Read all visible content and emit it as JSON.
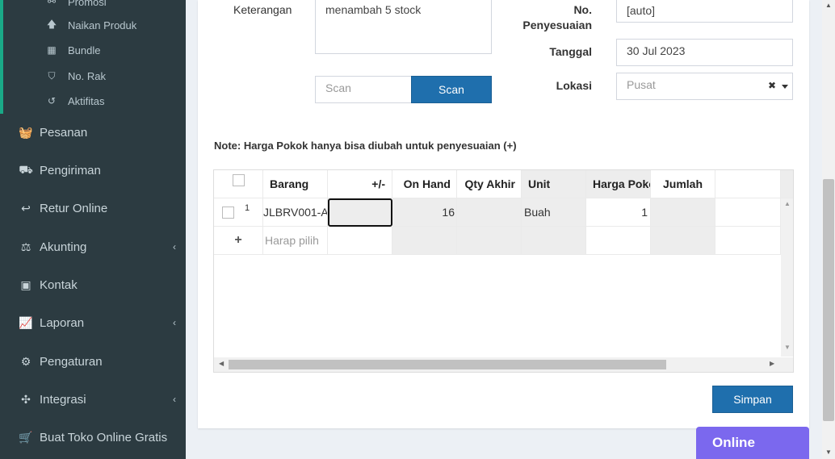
{
  "sidebar": {
    "submenu": [
      {
        "icon": "tag-icon",
        "label": "Promosi"
      },
      {
        "icon": "arrow-up-icon",
        "label": "Naikan Produk"
      },
      {
        "icon": "grid-icon",
        "label": "Bundle"
      },
      {
        "icon": "bookmark-icon",
        "label": "No. Rak"
      },
      {
        "icon": "history-icon",
        "label": "Aktifitas"
      }
    ],
    "menu": [
      {
        "icon": "basket-icon",
        "label": "Pesanan"
      },
      {
        "icon": "truck-icon",
        "label": "Pengiriman"
      },
      {
        "icon": "reply-icon",
        "label": "Retur Online"
      },
      {
        "icon": "scale-icon",
        "label": "Akunting"
      },
      {
        "icon": "id-card-icon",
        "label": "Kontak"
      },
      {
        "icon": "line-chart-icon",
        "label": "Laporan"
      },
      {
        "icon": "cogs-icon",
        "label": "Pengaturan"
      },
      {
        "icon": "puzzle-icon",
        "label": "Integrasi"
      },
      {
        "icon": "cart-icon",
        "label": "Buat Toko Online Gratis"
      }
    ]
  },
  "form": {
    "keterangan_label": "Keterangan",
    "keterangan_value": "menambah 5 stock",
    "scan_placeholder": "Scan",
    "scan_button": "Scan",
    "no_penyesuaian_label_1": "No.",
    "no_penyesuaian_label_2": "Penyesuaian",
    "no_penyesuaian_value": "[auto]",
    "tanggal_label": "Tanggal",
    "tanggal_value": "30 Jul 2023",
    "lokasi_label": "Lokasi",
    "lokasi_value": "Pusat",
    "clear_symbol": "✖",
    "note": "Note: Harga Pokok hanya bisa diubah untuk penyesuaian (+)"
  },
  "table": {
    "headers": {
      "barang": "Barang",
      "plusminus": "+/-",
      "on_hand": "On Hand",
      "qty_akhir": "Qty Akhir",
      "unit": "Unit",
      "harga_pokok": "Harga Poko",
      "jumlah": "Jumlah"
    },
    "rows": [
      {
        "no": "1",
        "barang": "JLBRV001-A",
        "plusminus": "",
        "on_hand": "16",
        "qty_akhir": "",
        "unit": "Buah",
        "harga_pokok": "1",
        "jumlah": ""
      }
    ],
    "add_placeholder": "Harap pilih",
    "add_symbol": "+"
  },
  "actions": {
    "save": "Simpan"
  },
  "chat": {
    "online": "Online"
  }
}
